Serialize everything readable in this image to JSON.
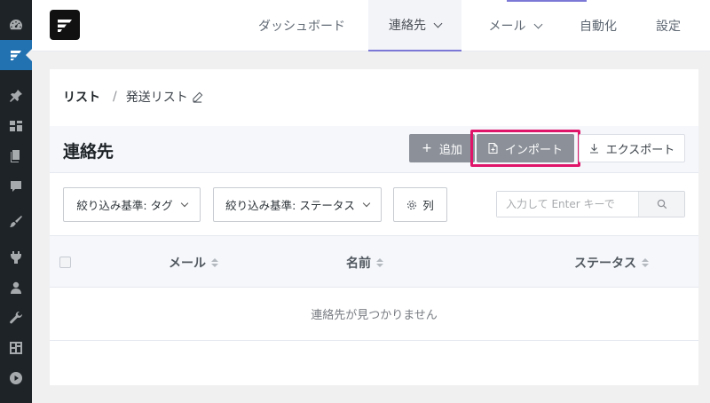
{
  "sidebar": {
    "icons": [
      "dashboard-icon",
      "fluentcrm-icon",
      "pin-icon",
      "media-icon",
      "pages-icon",
      "comments-icon",
      "appearance-icon",
      "plugins-icon",
      "users-icon",
      "tools-icon",
      "settings-icon",
      "play-icon"
    ]
  },
  "topnav": {
    "items": [
      {
        "label": "ダッシュボード"
      },
      {
        "label": "連絡先"
      },
      {
        "label": "メール"
      },
      {
        "label": "自動化"
      },
      {
        "label": "設定"
      }
    ],
    "active_index": 1
  },
  "breadcrumb": {
    "root": "リスト",
    "separator": "/",
    "current": "発送リスト"
  },
  "header": {
    "title": "連絡先",
    "add_label": "追加",
    "import_label": "インポート",
    "export_label": "エクスポート"
  },
  "filters": {
    "tag_label": "絞り込み基準: タグ",
    "status_label": "絞り込み基準: ステータス",
    "columns_label": "列"
  },
  "search": {
    "placeholder": "入力して Enter キーで"
  },
  "table": {
    "columns": [
      "メール",
      "名前",
      "ステータス"
    ],
    "empty_text": "連絡先が見つかりません"
  },
  "colors": {
    "accent": "#7c79d6",
    "highlight": "#e0156a",
    "wp_active": "#2271b1"
  }
}
